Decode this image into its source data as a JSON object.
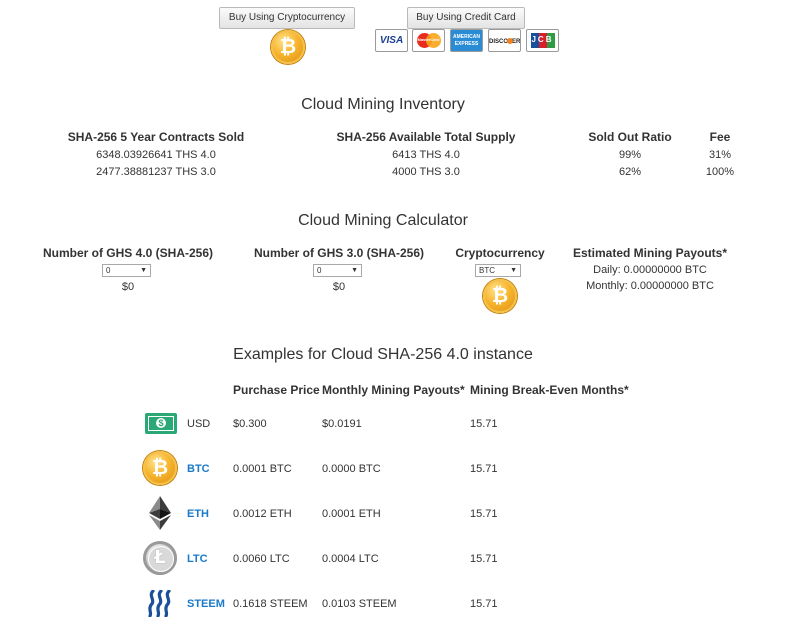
{
  "buttons": {
    "crypto": "Buy Using Cryptocurrency",
    "card": "Buy Using Credit Card"
  },
  "card_logos": [
    "VISA",
    "MasterCard",
    "AMERICAN EXPRESS",
    "DISCOVER",
    "JCB"
  ],
  "inventory": {
    "title": "Cloud Mining Inventory",
    "headers": [
      "SHA-256 5 Year Contracts Sold",
      "SHA-256 Available Total Supply",
      "Sold Out Ratio",
      "Fee"
    ],
    "rows": [
      [
        "6348.03926641 THS 4.0",
        "6413 THS 4.0",
        "99%",
        "31%"
      ],
      [
        "2477.38881237 THS 3.0",
        "4000 THS 3.0",
        "62%",
        "100%"
      ]
    ]
  },
  "calculator": {
    "title": "Cloud Mining Calculator",
    "ghs40": {
      "label": "Number of GHS 4.0 (SHA-256)",
      "value": "0",
      "cost": "$0"
    },
    "ghs30": {
      "label": "Number of GHS 3.0 (SHA-256)",
      "value": "0",
      "cost": "$0"
    },
    "crypto": {
      "label": "Cryptocurrency",
      "value": "BTC"
    },
    "payouts": {
      "label": "Estimated Mining Payouts*",
      "daily": "Daily: 0.00000000 BTC",
      "monthly": "Monthly: 0.00000000 BTC"
    }
  },
  "examples": {
    "title": "Examples for Cloud SHA-256 4.0 instance",
    "headers": [
      "Purchase Price",
      "Monthly Mining Payouts*",
      "Mining Break-Even Months*"
    ],
    "rows": [
      {
        "icon": "usd-icon",
        "symbol": "USD",
        "price": "$0.300",
        "monthly": "$0.0191",
        "breakeven": "15.71"
      },
      {
        "icon": "bitcoin-icon",
        "symbol": "BTC",
        "price": "0.0001 BTC",
        "monthly": "0.0000 BTC",
        "breakeven": "15.71"
      },
      {
        "icon": "ethereum-icon",
        "symbol": "ETH",
        "price": "0.0012 ETH",
        "monthly": "0.0001 ETH",
        "breakeven": "15.71"
      },
      {
        "icon": "litecoin-icon",
        "symbol": "LTC",
        "price": "0.0060 LTC",
        "monthly": "0.0004 LTC",
        "breakeven": "15.71"
      },
      {
        "icon": "steem-icon",
        "symbol": "STEEM",
        "price": "0.1618 STEEM",
        "monthly": "0.0103 STEEM",
        "breakeven": "15.71"
      }
    ]
  },
  "colors": {
    "link": "#1a7ac9",
    "coin": "#f7b32b",
    "usd": "#2aa876"
  }
}
